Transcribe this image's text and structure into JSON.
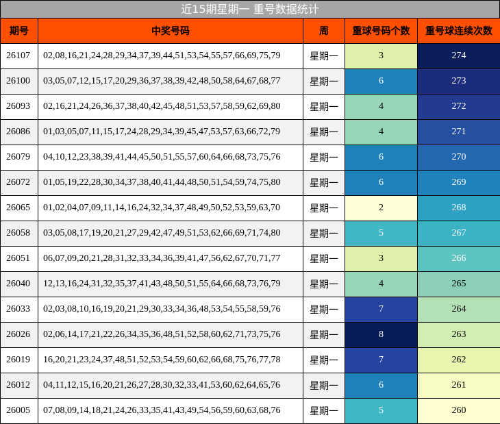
{
  "title": "近15期星期一 重号数据统计",
  "headers": [
    "期号",
    "中奖号码",
    "周",
    "重球号码个数",
    "重号球连续次数"
  ],
  "rows": [
    {
      "period": "26107",
      "numbers": "02,08,16,21,24,28,29,34,37,39,44,51,53,54,55,57,66,69,75,79",
      "week": "星期一",
      "count": "3",
      "count_color": "#dff0aa",
      "streak": "274",
      "streak_color": "#0b1d5a"
    },
    {
      "period": "26100",
      "numbers": "03,05,07,12,15,17,20,29,36,37,38,39,42,48,50,58,64,67,68,77",
      "week": "星期一",
      "count": "6",
      "count_color": "#1f80ba",
      "streak": "273",
      "streak_color": "#1a2c7a"
    },
    {
      "period": "26093",
      "numbers": "02,16,21,24,26,36,37,38,40,42,45,48,51,53,57,58,59,62,69,80",
      "week": "星期一",
      "count": "4",
      "count_color": "#97d5b9",
      "streak": "272",
      "streak_color": "#233a92"
    },
    {
      "period": "26086",
      "numbers": "01,03,05,07,11,15,17,24,28,29,34,39,45,47,53,57,63,66,72,79",
      "week": "星期一",
      "count": "4",
      "count_color": "#97d5b9",
      "streak": "271",
      "streak_color": "#2550a2"
    },
    {
      "period": "26079",
      "numbers": "04,10,12,23,38,39,41,44,45,50,51,55,57,60,64,66,68,73,75,76",
      "week": "星期一",
      "count": "6",
      "count_color": "#1f80ba",
      "streak": "270",
      "streak_color": "#2368af"
    },
    {
      "period": "26072",
      "numbers": "01,05,19,22,28,30,34,37,38,40,41,44,48,50,51,54,59,74,75,80",
      "week": "星期一",
      "count": "6",
      "count_color": "#1f80ba",
      "streak": "269",
      "streak_color": "#2082bd"
    },
    {
      "period": "26065",
      "numbers": "01,02,04,07,09,11,14,16,24,32,34,37,48,49,50,52,53,59,63,70",
      "week": "星期一",
      "count": "2",
      "count_color": "#ffffd8",
      "streak": "268",
      "streak_color": "#2ea0c4"
    },
    {
      "period": "26058",
      "numbers": "03,05,08,17,19,20,21,27,29,42,47,49,51,53,62,66,69,71,74,80",
      "week": "星期一",
      "count": "5",
      "count_color": "#41b6c4",
      "streak": "267",
      "streak_color": "#3cb3c4"
    },
    {
      "period": "26051",
      "numbers": "06,07,09,20,21,28,31,32,33,34,36,39,41,47,56,62,67,70,71,77",
      "week": "星期一",
      "count": "3",
      "count_color": "#dff0aa",
      "streak": "266",
      "streak_color": "#5ec4c0"
    },
    {
      "period": "26040",
      "numbers": "12,13,16,24,31,32,35,37,41,43,48,50,51,55,64,66,68,73,76,79",
      "week": "星期一",
      "count": "4",
      "count_color": "#97d5b9",
      "streak": "265",
      "streak_color": "#8ccfba"
    },
    {
      "period": "26033",
      "numbers": "02,03,08,10,16,19,20,21,29,30,33,34,36,48,53,54,55,58,59,76",
      "week": "星期一",
      "count": "7",
      "count_color": "#2444a0",
      "streak": "264",
      "streak_color": "#b3e1b6"
    },
    {
      "period": "26026",
      "numbers": "02,06,14,17,21,22,26,34,35,36,48,51,52,58,60,62,71,73,75,76",
      "week": "星期一",
      "count": "8",
      "count_color": "#081d58",
      "streak": "263",
      "streak_color": "#d2eeb2"
    },
    {
      "period": "26019",
      "numbers": "16,20,21,23,24,37,48,51,52,53,54,59,60,62,66,68,75,76,77,78",
      "week": "星期一",
      "count": "7",
      "count_color": "#2444a0",
      "streak": "262",
      "streak_color": "#e9f6b0"
    },
    {
      "period": "26012",
      "numbers": "04,11,12,15,16,20,21,26,27,28,30,32,33,41,53,60,62,64,65,76",
      "week": "星期一",
      "count": "6",
      "count_color": "#1f80ba",
      "streak": "261",
      "streak_color": "#f7fbc4"
    },
    {
      "period": "26005",
      "numbers": "07,08,09,14,18,21,24,26,33,35,41,43,49,54,56,59,60,63,68,76",
      "week": "星期一",
      "count": "5",
      "count_color": "#41b6c4",
      "streak": "260",
      "streak_color": "#ffffd2"
    }
  ]
}
